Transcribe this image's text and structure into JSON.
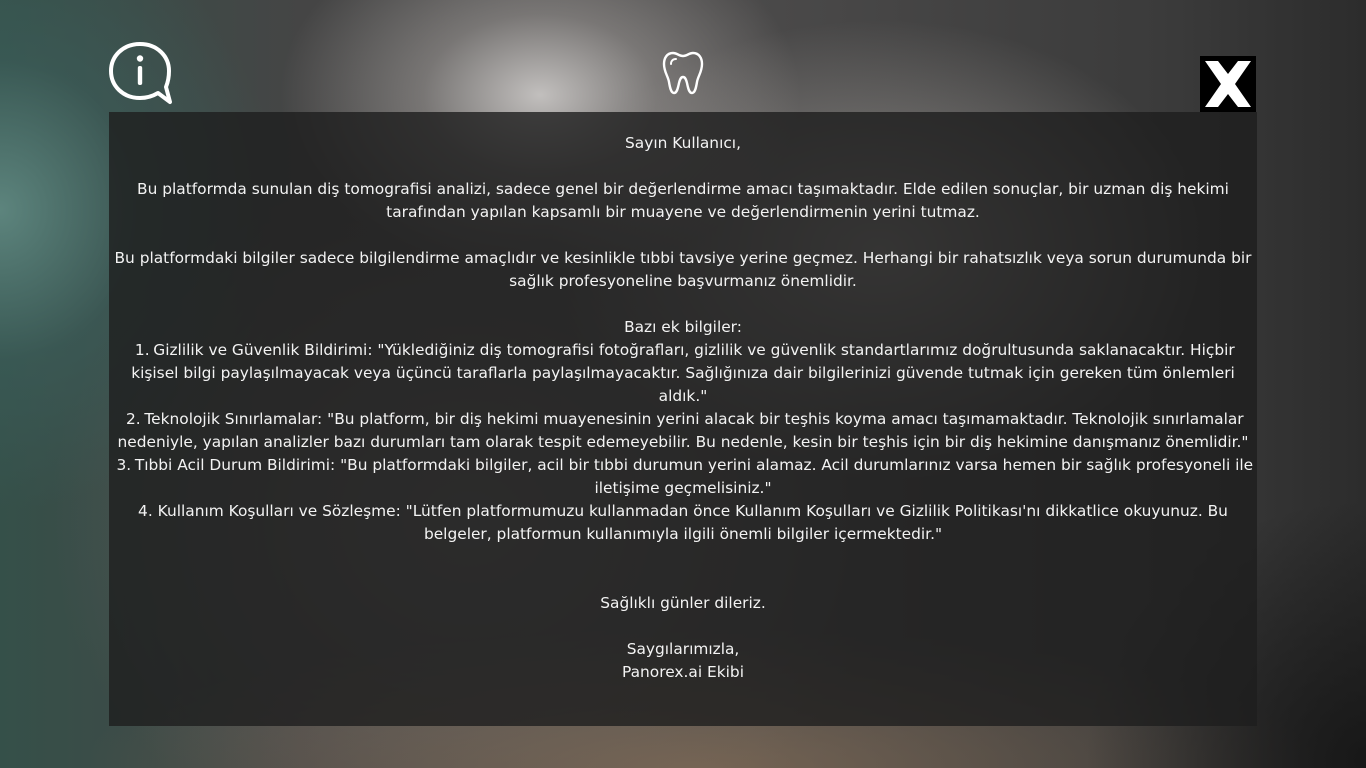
{
  "icons": {
    "info": "info-speech-bubble-icon",
    "tooth": "tooth-icon",
    "close": "close-x-icon"
  },
  "colors": {
    "panel_bg": "#1e1e1e",
    "text": "#f3f3f3",
    "close_bg": "#000000",
    "close_fg": "#ffffff"
  },
  "disclaimer": {
    "greeting": "Sayın Kullanıcı,",
    "paragraph1": "Bu platformda sunulan diş tomografisi analizi, sadece genel bir değerlendirme amacı taşımaktadır. Elde edilen sonuçlar, bir uzman diş hekimi tarafından yapılan kapsamlı bir muayene ve değerlendirmenin yerini tutmaz.",
    "paragraph2": "Bu platformdaki bilgiler sadece bilgilendirme amaçlıdır ve kesinlikle tıbbi tavsiye yerine geçmez. Herhangi bir rahatsızlık veya sorun durumunda bir sağlık profesyoneline başvurmanız önemlidir.",
    "extra_heading": "Bazı ek bilgiler:",
    "items": [
      {
        "number": "1.",
        "text": "Gizlilik ve Güvenlik Bildirimi: \"Yüklediğiniz diş tomografisi fotoğrafları, gizlilik ve güvenlik standartlarımız doğrultusunda saklanacaktır. Hiçbir kişisel bilgi paylaşılmayacak veya üçüncü taraflarla paylaşılmayacaktır. Sağlığınıza dair bilgilerinizi güvende tutmak için gereken tüm önlemleri aldık.\""
      },
      {
        "number": "2.",
        "text": "Teknolojik Sınırlamalar: \"Bu platform, bir diş hekimi muayenesinin yerini alacak bir teşhis koyma amacı taşımamaktadır. Teknolojik sınırlamalar nedeniyle, yapılan analizler bazı durumları tam olarak tespit edemeyebilir. Bu nedenle, kesin bir teşhis için bir diş hekimine danışmanız önemlidir.\""
      },
      {
        "number": "3.",
        "text": "Tıbbi Acil Durum Bildirimi: \"Bu platformdaki bilgiler, acil bir tıbbi durumun yerini alamaz. Acil durumlarınız varsa hemen bir sağlık profesyoneli ile iletişime geçmelisiniz.\""
      },
      {
        "number": "4.",
        "text": "Kullanım Koşulları ve Sözleşme: \"Lütfen platformumuzu kullanmadan önce Kullanım Koşulları ve Gizlilik Politikası'nı dikkatlice okuyunuz. Bu belgeler, platformun kullanımıyla ilgili önemli bilgiler içermektedir.\""
      }
    ],
    "closing": "Sağlıklı günler dileriz.",
    "signoff": "Saygılarımızla,",
    "team": "Panorex.ai Ekibi"
  }
}
